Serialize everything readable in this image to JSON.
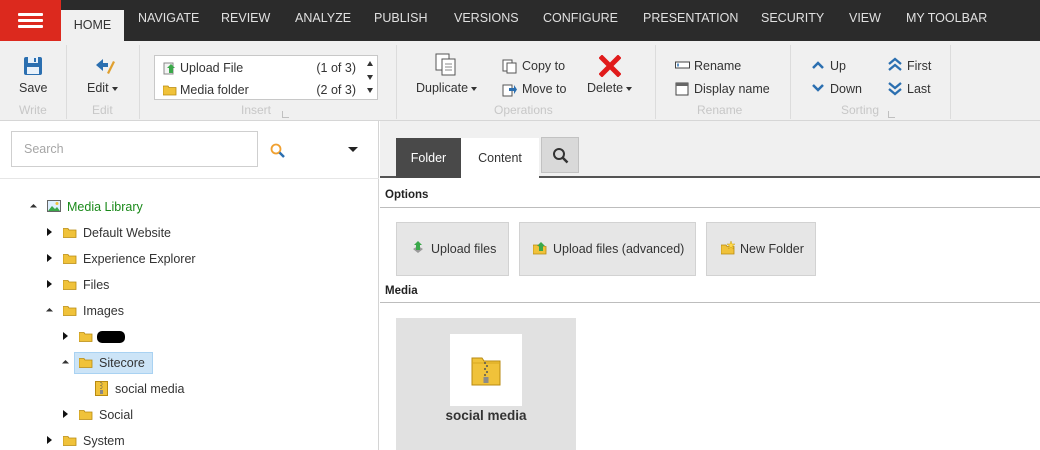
{
  "tabs": [
    "HOME",
    "NAVIGATE",
    "REVIEW",
    "ANALYZE",
    "PUBLISH",
    "VERSIONS",
    "CONFIGURE",
    "PRESENTATION",
    "SECURITY",
    "VIEW",
    "MY TOOLBAR"
  ],
  "active_tab": "HOME",
  "ribbon": {
    "write": {
      "save_label": "Save",
      "title": "Write"
    },
    "edit": {
      "edit_label": "Edit",
      "title": "Edit"
    },
    "insert": {
      "title": "Insert",
      "items": [
        {
          "label": "Upload File",
          "count": "(1 of 3)"
        },
        {
          "label": "Media folder",
          "count": "(2 of 3)"
        }
      ]
    },
    "operations": {
      "title": "Operations",
      "duplicate": "Duplicate",
      "copy_to": "Copy to",
      "move_to": "Move to",
      "delete": "Delete"
    },
    "rename": {
      "title": "Rename",
      "rename": "Rename",
      "display_name": "Display name"
    },
    "sorting": {
      "title": "Sorting",
      "up": "Up",
      "down": "Down",
      "first": "First",
      "last": "Last"
    }
  },
  "search": {
    "placeholder": "Search"
  },
  "tree": {
    "root": "Media Library",
    "items": {
      "default_website": "Default Website",
      "experience_explorer": "Experience Explorer",
      "files": "Files",
      "images": "Images",
      "sitecore": "Sitecore",
      "social_media": "social media",
      "social": "Social",
      "system": "System"
    }
  },
  "content_tabs": {
    "folder": "Folder",
    "content": "Content"
  },
  "options": {
    "title": "Options",
    "upload_files": "Upload files",
    "upload_files_advanced": "Upload files (advanced)",
    "new_folder": "New Folder"
  },
  "media": {
    "title": "Media",
    "items": [
      {
        "label": "social media"
      }
    ]
  },
  "colors": {
    "menu_button": "#dc291e",
    "topbar": "#2b2b2b",
    "ribbon": "#f0f0f0",
    "icon_blue": "#2b6fb0",
    "delete_red": "#e11b1b",
    "tree_root_green": "#1a8a1a",
    "selected_item": "#cce4f7"
  }
}
